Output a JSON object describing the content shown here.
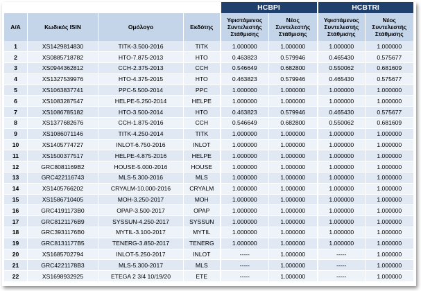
{
  "groups": {
    "hcbpi": "HCBPI",
    "hcbtri": "HCBTRI"
  },
  "headers": {
    "aa": "Α/Α",
    "isin": "Κωδικός ISIN",
    "bond": "Ομόλογο",
    "issuer": "Εκδότης",
    "existing_weight": "Υφιστάμενος Συντελεστής Στάθμισης",
    "new_weight": "Νέος Συντελεστής Στάθμισης"
  },
  "rows": [
    {
      "aa": "1",
      "isin": "XS1429814830",
      "bond": "TITK-3.500-2016",
      "issuer": "TITK",
      "hcbpi_existing": "1.000000",
      "hcbpi_new": "1.000000",
      "hcbtri_existing": "1.000000",
      "hcbtri_new": "1.000000"
    },
    {
      "aa": "2",
      "isin": "XS0885718782",
      "bond": "HTO-7.875-2013",
      "issuer": "HTO",
      "hcbpi_existing": "0.463823",
      "hcbpi_new": "0.579946",
      "hcbtri_existing": "0.465430",
      "hcbtri_new": "0.575677"
    },
    {
      "aa": "3",
      "isin": "XS0944362812",
      "bond": "CCH-2.375-2013",
      "issuer": "CCH",
      "hcbpi_existing": "0.546649",
      "hcbpi_new": "0.682800",
      "hcbtri_existing": "0.550062",
      "hcbtri_new": "0.681609"
    },
    {
      "aa": "4",
      "isin": "XS1327539976",
      "bond": "HTO-4.375-2015",
      "issuer": "HTO",
      "hcbpi_existing": "0.463823",
      "hcbpi_new": "0.579946",
      "hcbtri_existing": "0.465430",
      "hcbtri_new": "0.575677"
    },
    {
      "aa": "5",
      "isin": "XS1063837741",
      "bond": "PPC-5.500-2014",
      "issuer": "PPC",
      "hcbpi_existing": "1.000000",
      "hcbpi_new": "1.000000",
      "hcbtri_existing": "1.000000",
      "hcbtri_new": "1.000000"
    },
    {
      "aa": "6",
      "isin": "XS1083287547",
      "bond": "HELPE-5.250-2014",
      "issuer": "HELPE",
      "hcbpi_existing": "1.000000",
      "hcbpi_new": "1.000000",
      "hcbtri_existing": "1.000000",
      "hcbtri_new": "1.000000"
    },
    {
      "aa": "7",
      "isin": "XS1086785182",
      "bond": "HTO-3.500-2014",
      "issuer": "HTO",
      "hcbpi_existing": "0.463823",
      "hcbpi_new": "0.579946",
      "hcbtri_existing": "0.465430",
      "hcbtri_new": "0.575677"
    },
    {
      "aa": "8",
      "isin": "XS1377682676",
      "bond": "CCH-1.875-2016",
      "issuer": "CCH",
      "hcbpi_existing": "0.546649",
      "hcbpi_new": "0.682800",
      "hcbtri_existing": "0.550062",
      "hcbtri_new": "0.681609"
    },
    {
      "aa": "9",
      "isin": "XS1086071146",
      "bond": "TITK-4.250-2014",
      "issuer": "TITK",
      "hcbpi_existing": "1.000000",
      "hcbpi_new": "1.000000",
      "hcbtri_existing": "1.000000",
      "hcbtri_new": "1.000000"
    },
    {
      "aa": "10",
      "isin": "XS1405774727",
      "bond": "INLOT-6.750-2016",
      "issuer": "INLOT",
      "hcbpi_existing": "1.000000",
      "hcbpi_new": "1.000000",
      "hcbtri_existing": "1.000000",
      "hcbtri_new": "1.000000"
    },
    {
      "aa": "11",
      "isin": "XS1500377517",
      "bond": "HELPE-4.875-2016",
      "issuer": "HELPE",
      "hcbpi_existing": "1.000000",
      "hcbpi_new": "1.000000",
      "hcbtri_existing": "1.000000",
      "hcbtri_new": "1.000000"
    },
    {
      "aa": "12",
      "isin": "GRC8081169B2",
      "bond": "HOUSE-5.000-2016",
      "issuer": "HOUSE",
      "hcbpi_existing": "1.000000",
      "hcbpi_new": "1.000000",
      "hcbtri_existing": "1.000000",
      "hcbtri_new": "1.000000"
    },
    {
      "aa": "13",
      "isin": "GRC422116743",
      "bond": "MLS-5.300-2016",
      "issuer": "MLS",
      "hcbpi_existing": "1.000000",
      "hcbpi_new": "1.000000",
      "hcbtri_existing": "1.000000",
      "hcbtri_new": "1.000000"
    },
    {
      "aa": "14",
      "isin": "XS1405766202",
      "bond": "CRYALM-10.000-2016",
      "issuer": "CRYALM",
      "hcbpi_existing": "1.000000",
      "hcbpi_new": "1.000000",
      "hcbtri_existing": "1.000000",
      "hcbtri_new": "1.000000"
    },
    {
      "aa": "15",
      "isin": "XS1586710405",
      "bond": "MOH-3.250-2017",
      "issuer": "MOH",
      "hcbpi_existing": "1.000000",
      "hcbpi_new": "1.000000",
      "hcbtri_existing": "1.000000",
      "hcbtri_new": "1.000000"
    },
    {
      "aa": "16",
      "isin": "GRC4191173B0",
      "bond": "OPAP-3.500-2017",
      "issuer": "OPAP",
      "hcbpi_existing": "1.000000",
      "hcbpi_new": "1.000000",
      "hcbtri_existing": "1.000000",
      "hcbtri_new": "1.000000"
    },
    {
      "aa": "17",
      "isin": "GRC8121176B9",
      "bond": "SYSSUN-4.250-2017",
      "issuer": "SYSSUN",
      "hcbpi_existing": "1.000000",
      "hcbpi_new": "1.000000",
      "hcbtri_existing": "1.000000",
      "hcbtri_new": "1.000000"
    },
    {
      "aa": "18",
      "isin": "GRC3931176B0",
      "bond": "MYTIL-3.100-2017",
      "issuer": "MYTIL",
      "hcbpi_existing": "1.000000",
      "hcbpi_new": "1.000000",
      "hcbtri_existing": "1.000000",
      "hcbtri_new": "1.000000"
    },
    {
      "aa": "19",
      "isin": "GRC8131177B5",
      "bond": "TENERG-3.850-2017",
      "issuer": "TENERG",
      "hcbpi_existing": "1.000000",
      "hcbpi_new": "1.000000",
      "hcbtri_existing": "1.000000",
      "hcbtri_new": "1.000000"
    },
    {
      "aa": "20",
      "isin": "XS1685702794",
      "bond": "INLOT-5.250-2017",
      "issuer": "INLOT",
      "hcbpi_existing": "-----",
      "hcbpi_new": "1.000000",
      "hcbtri_existing": "-----",
      "hcbtri_new": "1.000000"
    },
    {
      "aa": "21",
      "isin": "GRC4221178B3",
      "bond": "MLS-5.300-2017",
      "issuer": "MLS",
      "hcbpi_existing": "-----",
      "hcbpi_new": "1.000000",
      "hcbtri_existing": "-----",
      "hcbtri_new": "1.000000"
    },
    {
      "aa": "22",
      "isin": "XS1698932925",
      "bond": "ETEGA 2 3/4 10/19/20",
      "issuer": "ETE",
      "hcbpi_existing": "-----",
      "hcbpi_new": "1.000000",
      "hcbtri_existing": "-----",
      "hcbtri_new": "1.000000"
    }
  ]
}
